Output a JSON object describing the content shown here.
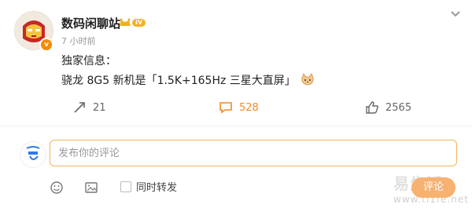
{
  "post": {
    "author": "数码闲聊站",
    "level_badge": "IV",
    "time": "7 小时前",
    "text_line1": "独家信息：",
    "text_line2": "骁龙 8G5 新机是「1.5K+165Hz 三星大直屏」"
  },
  "actions": {
    "repost_count": "21",
    "comment_count": "528",
    "like_count": "2565"
  },
  "comment": {
    "placeholder": "发布你的评论",
    "repost_checkbox_label": "同时转发",
    "submit_label": "评论"
  },
  "watermark": {
    "text": "www.tl1fe.net",
    "big": "易生活"
  },
  "colors": {
    "accent": "#f28b1f",
    "submit_bg": "#f7b171",
    "input_border": "#f2b35a"
  }
}
